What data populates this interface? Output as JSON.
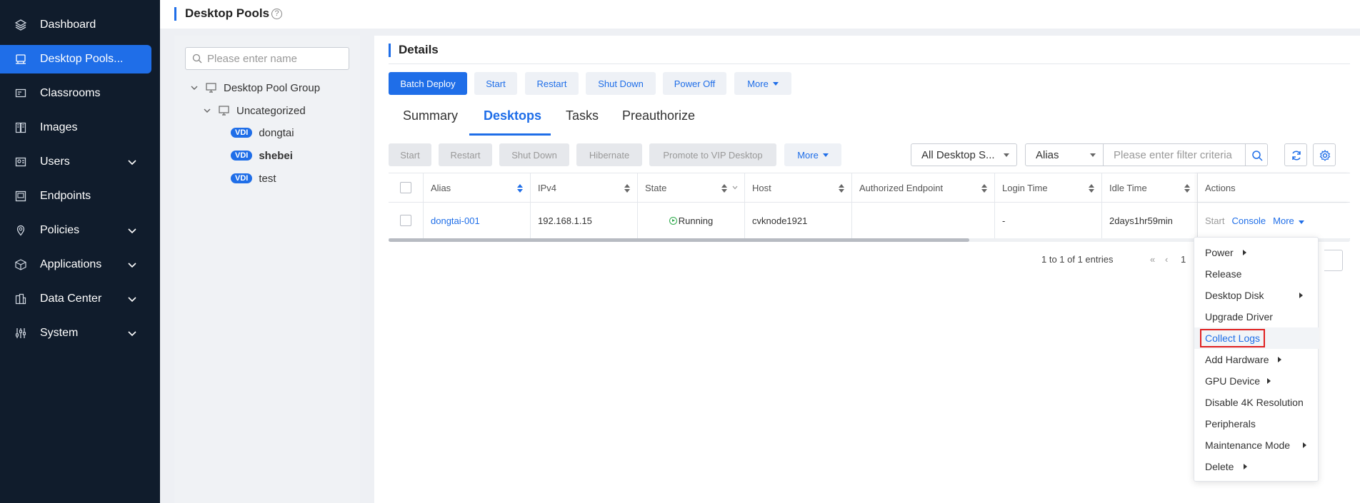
{
  "sidebar": {
    "items": [
      {
        "label": "Dashboard",
        "icon": "layers-icon"
      },
      {
        "label": "Desktop Pools...",
        "icon": "desktop-pool-icon",
        "active": true
      },
      {
        "label": "Classrooms",
        "icon": "classroom-icon"
      },
      {
        "label": "Images",
        "icon": "images-icon"
      },
      {
        "label": "Users",
        "icon": "users-icon",
        "expandable": true
      },
      {
        "label": "Endpoints",
        "icon": "endpoints-icon"
      },
      {
        "label": "Policies",
        "icon": "policies-icon",
        "expandable": true
      },
      {
        "label": "Applications",
        "icon": "applications-icon",
        "expandable": true
      },
      {
        "label": "Data Center",
        "icon": "data-center-icon",
        "expandable": true
      },
      {
        "label": "System",
        "icon": "system-icon",
        "expandable": true
      }
    ]
  },
  "header": {
    "title": "Desktop Pools",
    "help": "?"
  },
  "tree": {
    "search_placeholder": "Please enter name",
    "root": "Desktop Pool Group",
    "group": "Uncategorized",
    "tag": "VDI",
    "pools": [
      "dongtai",
      "shebei",
      "test"
    ]
  },
  "details": {
    "title": "Details",
    "toolbar": {
      "batch_deploy": "Batch Deploy",
      "start": "Start",
      "restart": "Restart",
      "shut_down": "Shut Down",
      "power_off": "Power Off",
      "more": "More"
    },
    "tabs": [
      "Summary",
      "Desktops",
      "Tasks",
      "Preauthorize"
    ],
    "active_tab": "Desktops",
    "sub_toolbar": {
      "start": "Start",
      "restart": "Restart",
      "shut_down": "Shut Down",
      "hibernate": "Hibernate",
      "promote": "Promote to VIP Desktop",
      "more": "More"
    },
    "filter": {
      "status_select": "All Desktop S...",
      "field_select": "Alias",
      "placeholder": "Please enter filter criteria"
    },
    "table": {
      "columns": [
        "Alias",
        "IPv4",
        "State",
        "Host",
        "Authorized Endpoint",
        "Login Time",
        "Idle Time",
        "Actions"
      ],
      "rows": [
        {
          "alias": "dongtai-001",
          "ipv4": "192.168.1.15",
          "state": "Running",
          "host": "cvknode1921",
          "authorized_endpoint": "",
          "login_time": "-",
          "idle_time": "2days1hr59min",
          "actions": {
            "start": "Start",
            "console": "Console",
            "more": "More"
          }
        }
      ]
    },
    "pager": {
      "summary": "1 to 1 of 1 entries",
      "page": "1"
    }
  },
  "context_menu": {
    "items": [
      {
        "label": "Power",
        "submenu": true
      },
      {
        "label": "Release",
        "submenu": false
      },
      {
        "label": "Desktop Disk",
        "submenu": true
      },
      {
        "label": "Upgrade Driver",
        "submenu": false
      },
      {
        "label": "Collect Logs",
        "submenu": false,
        "highlighted": true
      },
      {
        "label": "Add Hardware",
        "submenu": true
      },
      {
        "label": "GPU Device",
        "submenu": true
      },
      {
        "label": "Disable 4K Resolution",
        "submenu": false
      },
      {
        "label": "Peripherals",
        "submenu": false
      },
      {
        "label": "Maintenance Mode",
        "submenu": true
      },
      {
        "label": "Delete",
        "submenu": true
      }
    ]
  },
  "colors": {
    "accent": "#1f6ee8",
    "sidebar_bg": "#101c2c",
    "running": "#2eaa4b",
    "highlight_border": "#e02020"
  }
}
